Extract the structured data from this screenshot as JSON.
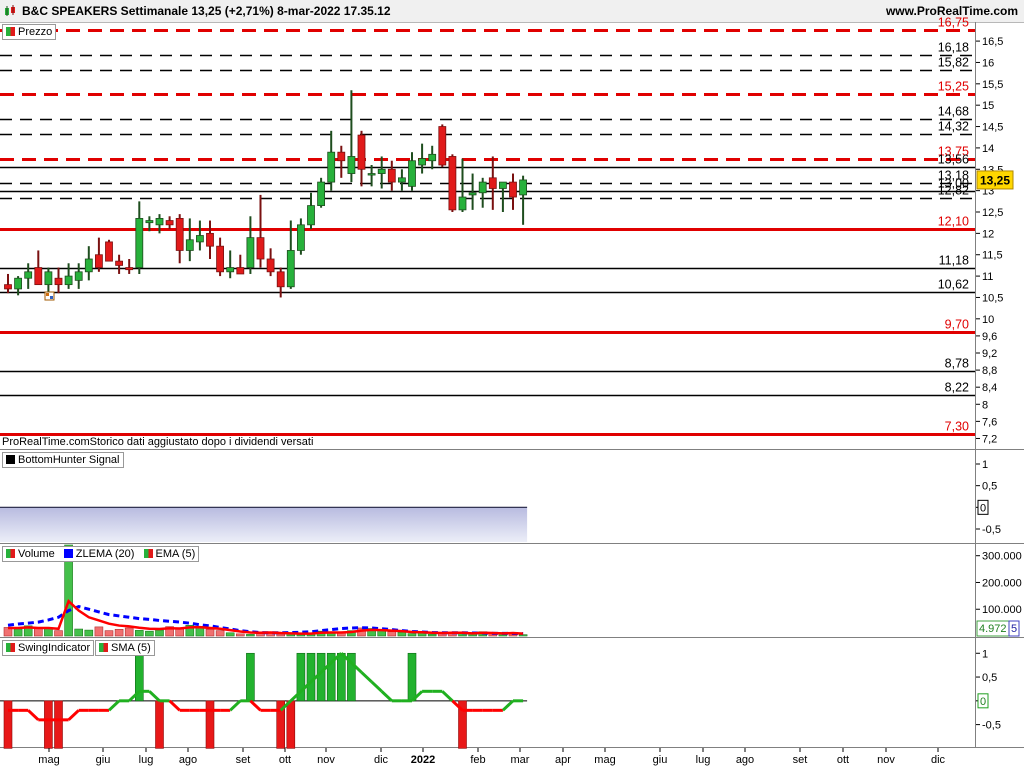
{
  "header": {
    "title": "B&C SPEAKERS Settimanale 13,25 (+2,71%) 8-mar-2022 17.35.12",
    "site": "www.ProRealTime.com"
  },
  "price_panel": {
    "label": "Prezzo",
    "source_note": "ProRealTime.comStorico dati aggiustato dopo i dividendi versati",
    "last_price_tag": "13,25",
    "levels": [
      {
        "value": 16.75,
        "label": "16,75",
        "style": "red-dash",
        "color": "#e00000"
      },
      {
        "value": 16.18,
        "label": "16,18",
        "style": "black-dash",
        "color": "#000000"
      },
      {
        "value": 15.82,
        "label": "15,82",
        "style": "black-dash",
        "color": "#000000"
      },
      {
        "value": 15.25,
        "label": "15,25",
        "style": "red-dash",
        "color": "#e00000"
      },
      {
        "value": 14.68,
        "label": "14,68",
        "style": "black-dash",
        "color": "#000000"
      },
      {
        "value": 14.32,
        "label": "14,32",
        "style": "black-dash",
        "color": "#000000"
      },
      {
        "value": 13.75,
        "label": "13,75",
        "style": "red-dash",
        "color": "#e00000"
      },
      {
        "value": 13.56,
        "label": "13,56",
        "style": "black-solid",
        "color": "#000000"
      },
      {
        "value": 13.18,
        "label": "13,18",
        "style": "black-dash",
        "color": "#000000"
      },
      {
        "value": 13.0,
        "label": "13,00",
        "style": "black-solid",
        "color": "#000000"
      },
      {
        "value": 12.82,
        "label": "12,82",
        "style": "black-dash",
        "color": "#000000"
      },
      {
        "value": 12.1,
        "label": "12,10",
        "style": "red-solid",
        "color": "#e00000"
      },
      {
        "value": 11.18,
        "label": "11,18",
        "style": "black-solid",
        "color": "#000000"
      },
      {
        "value": 10.62,
        "label": "10,62",
        "style": "black-solid",
        "color": "#000000"
      },
      {
        "value": 9.7,
        "label": "9,70",
        "style": "red-solid",
        "color": "#e00000"
      },
      {
        "value": 8.78,
        "label": "8,78",
        "style": "black-solid",
        "color": "#000000"
      },
      {
        "value": 8.22,
        "label": "8,22",
        "style": "black-solid",
        "color": "#000000"
      },
      {
        "value": 7.3,
        "label": "7,30",
        "style": "red-solid",
        "color": "#e00000"
      }
    ]
  },
  "bottomhunter_panel": {
    "label": "BottomHunter Signal",
    "axis_ticks": [
      "1",
      "0,5",
      "0",
      "-0,5"
    ],
    "value_tag": "0"
  },
  "volume_panel": {
    "labels": [
      "Volume",
      "ZLEMA (20)",
      "EMA (5)"
    ],
    "axis_ticks": [
      "300.000",
      "200.000",
      "100.000"
    ],
    "value_tag": "4.972",
    "value_tag2": "5"
  },
  "swing_panel": {
    "labels": [
      "SwingIndicator",
      "SMA (5)"
    ],
    "axis_ticks": [
      "1",
      "0,5",
      "0",
      "-0,5"
    ],
    "value_tag": "0"
  },
  "x_axis": {
    "labels": [
      "mag",
      "giu",
      "lug",
      "ago",
      "set",
      "ott",
      "nov",
      "dic",
      "2022",
      "feb",
      "mar",
      "apr",
      "mag",
      "giu",
      "lug",
      "ago",
      "set",
      "ott",
      "nov",
      "dic"
    ]
  },
  "colors": {
    "up": "#27b13b",
    "down": "#e11a1a",
    "wick": "#1e4d1e",
    "zlema": "#0000ff",
    "ema": "#ff0000",
    "swing_sma": "#20b020"
  },
  "chart_data": [
    {
      "type": "candlestick",
      "title": "B&C SPEAKERS Settimanale",
      "ylim": [
        7.0,
        16.9
      ],
      "y_ticks": [
        16.5,
        16,
        15.5,
        15,
        14.5,
        14,
        13.5,
        13,
        12.5,
        12,
        11.5,
        11,
        10.5,
        10,
        9.6,
        9.2,
        8.8,
        8.4,
        8,
        7.6,
        7.2
      ],
      "y_tick_labels": [
        "16,5",
        "16",
        "15,5",
        "15",
        "14,5",
        "14",
        "13,5",
        "13",
        "12,5",
        "12",
        "11,5",
        "11",
        "10,5",
        "10",
        "9,6",
        "9,2",
        "8,8",
        "8,4",
        "8",
        "7,6",
        "7,2"
      ],
      "candles": [
        {
          "o": 10.8,
          "h": 11.05,
          "l": 10.6,
          "c": 10.7
        },
        {
          "o": 10.7,
          "h": 11.0,
          "l": 10.55,
          "c": 10.95
        },
        {
          "o": 10.95,
          "h": 11.3,
          "l": 10.7,
          "c": 11.1
        },
        {
          "o": 11.2,
          "h": 11.6,
          "l": 10.8,
          "c": 10.8
        },
        {
          "o": 10.8,
          "h": 11.2,
          "l": 10.5,
          "c": 11.1
        },
        {
          "o": 10.95,
          "h": 11.2,
          "l": 10.6,
          "c": 10.8
        },
        {
          "o": 10.8,
          "h": 11.3,
          "l": 10.7,
          "c": 11.0
        },
        {
          "o": 10.9,
          "h": 11.3,
          "l": 10.7,
          "c": 11.1
        },
        {
          "o": 11.1,
          "h": 11.7,
          "l": 10.9,
          "c": 11.4
        },
        {
          "o": 11.5,
          "h": 11.9,
          "l": 11.1,
          "c": 11.2
        },
        {
          "o": 11.8,
          "h": 11.85,
          "l": 11.35,
          "c": 11.35
        },
        {
          "o": 11.35,
          "h": 11.5,
          "l": 11.05,
          "c": 11.25
        },
        {
          "o": 11.2,
          "h": 11.4,
          "l": 11.05,
          "c": 11.15
        },
        {
          "o": 11.2,
          "h": 12.75,
          "l": 11.05,
          "c": 12.35
        },
        {
          "o": 12.25,
          "h": 12.4,
          "l": 12.05,
          "c": 12.3
        },
        {
          "o": 12.2,
          "h": 12.45,
          "l": 12.0,
          "c": 12.35
        },
        {
          "o": 12.3,
          "h": 12.4,
          "l": 12.1,
          "c": 12.2
        },
        {
          "o": 12.35,
          "h": 12.45,
          "l": 11.3,
          "c": 11.6
        },
        {
          "o": 11.6,
          "h": 12.35,
          "l": 11.35,
          "c": 11.85
        },
        {
          "o": 11.8,
          "h": 12.3,
          "l": 11.6,
          "c": 11.95
        },
        {
          "o": 12.0,
          "h": 12.3,
          "l": 11.4,
          "c": 11.7
        },
        {
          "o": 11.7,
          "h": 11.9,
          "l": 11.0,
          "c": 11.1
        },
        {
          "o": 11.1,
          "h": 11.6,
          "l": 10.95,
          "c": 11.2
        },
        {
          "o": 11.2,
          "h": 11.5,
          "l": 11.05,
          "c": 11.05
        },
        {
          "o": 11.2,
          "h": 12.4,
          "l": 11.05,
          "c": 11.9
        },
        {
          "o": 11.9,
          "h": 12.9,
          "l": 11.2,
          "c": 11.4
        },
        {
          "o": 11.4,
          "h": 11.65,
          "l": 11.0,
          "c": 11.1
        },
        {
          "o": 11.1,
          "h": 11.2,
          "l": 10.5,
          "c": 10.75
        },
        {
          "o": 10.75,
          "h": 12.3,
          "l": 10.7,
          "c": 11.6
        },
        {
          "o": 11.6,
          "h": 12.35,
          "l": 11.5,
          "c": 12.2
        },
        {
          "o": 12.2,
          "h": 12.95,
          "l": 12.1,
          "c": 12.65
        },
        {
          "o": 12.65,
          "h": 13.3,
          "l": 12.6,
          "c": 13.2
        },
        {
          "o": 13.2,
          "h": 14.4,
          "l": 13.0,
          "c": 13.9
        },
        {
          "o": 13.9,
          "h": 14.05,
          "l": 13.3,
          "c": 13.7
        },
        {
          "o": 13.4,
          "h": 15.35,
          "l": 13.2,
          "c": 13.8
        },
        {
          "o": 14.3,
          "h": 14.4,
          "l": 13.1,
          "c": 13.5
        },
        {
          "o": 13.4,
          "h": 13.6,
          "l": 13.1,
          "c": 13.4
        },
        {
          "o": 13.4,
          "h": 13.8,
          "l": 13.05,
          "c": 13.5
        },
        {
          "o": 13.5,
          "h": 13.7,
          "l": 13.0,
          "c": 13.2
        },
        {
          "o": 13.2,
          "h": 13.5,
          "l": 13.0,
          "c": 13.3
        },
        {
          "o": 13.1,
          "h": 13.9,
          "l": 13.0,
          "c": 13.7
        },
        {
          "o": 13.6,
          "h": 14.1,
          "l": 13.4,
          "c": 13.75
        },
        {
          "o": 13.7,
          "h": 14.05,
          "l": 13.5,
          "c": 13.85
        },
        {
          "o": 14.5,
          "h": 14.55,
          "l": 13.55,
          "c": 13.6
        },
        {
          "o": 13.8,
          "h": 13.85,
          "l": 12.5,
          "c": 12.55
        },
        {
          "o": 12.55,
          "h": 13.75,
          "l": 12.5,
          "c": 12.85
        },
        {
          "o": 12.9,
          "h": 13.4,
          "l": 12.55,
          "c": 12.95
        },
        {
          "o": 12.95,
          "h": 13.3,
          "l": 12.6,
          "c": 13.2
        },
        {
          "o": 13.3,
          "h": 13.8,
          "l": 12.55,
          "c": 13.05
        },
        {
          "o": 13.05,
          "h": 13.2,
          "l": 12.5,
          "c": 13.2
        },
        {
          "o": 13.2,
          "h": 13.4,
          "l": 12.55,
          "c": 12.85
        },
        {
          "o": 12.9,
          "h": 13.35,
          "l": 12.2,
          "c": 13.25
        }
      ]
    },
    {
      "type": "area",
      "title": "BottomHunter Signal",
      "ylim": [
        -0.8,
        1.3
      ],
      "values": [
        0.0,
        0.0,
        0.0,
        0.0,
        0.0,
        0.0,
        0.0,
        0.0,
        0.0,
        0.0,
        0.0,
        0.0,
        0.0,
        0.0,
        0.0,
        0.0,
        0.0,
        0.0,
        0.0,
        0.0,
        0.0,
        0.0,
        0.0,
        0.0,
        0.0,
        0.0,
        0.0,
        0.0,
        0.0,
        0.0,
        0.0,
        0.0,
        0.0,
        0.0,
        0.0,
        0.0,
        0.0,
        0.0,
        0.0,
        0.0,
        0.0,
        0.0,
        0.0,
        0.0,
        0.0,
        0.0,
        0.0,
        0.0,
        0.0,
        0.0,
        0.0,
        0.0
      ]
    },
    {
      "type": "bar",
      "title": "Volume",
      "ylim": [
        0,
        340000
      ],
      "series": [
        {
          "name": "Volume",
          "values": [
            32000,
            26000,
            38000,
            28000,
            30000,
            20000,
            340000,
            26000,
            22000,
            34000,
            20000,
            25000,
            30000,
            21000,
            18000,
            22000,
            35000,
            26000,
            40000,
            36000,
            25000,
            20000,
            12000,
            8000,
            6000,
            9000,
            14000,
            7000,
            10000,
            6000,
            8000,
            18000,
            16000,
            12000,
            20000,
            30000,
            28000,
            22000,
            16000,
            14000,
            9000,
            11000,
            7000,
            9000,
            14000,
            12000,
            8000,
            16000,
            10000,
            9000,
            12000,
            5000
          ]
        },
        {
          "name": "ZLEMA (20)",
          "values": [
            40000,
            45000,
            48000,
            52000,
            60000,
            70000,
            95000,
            110000,
            100000,
            90000,
            80000,
            75000,
            70000,
            65000,
            62000,
            58000,
            55000,
            52000,
            48000,
            42000,
            38000,
            32000,
            26000,
            20000,
            16000,
            13000,
            12000,
            12000,
            13000,
            14000,
            16000,
            20000,
            24000,
            28000,
            30000,
            31000,
            30000,
            27000,
            24000,
            20000,
            17000,
            15000,
            13000,
            12000,
            12000,
            12000,
            11000,
            11000,
            10000,
            10000,
            9500,
            9000
          ]
        },
        {
          "name": "EMA (5)",
          "values": [
            30000,
            30000,
            32000,
            30000,
            30000,
            27000,
            130000,
            95000,
            70000,
            58000,
            46000,
            39000,
            36000,
            31000,
            27000,
            26000,
            29000,
            28000,
            32000,
            33000,
            30000,
            27000,
            22000,
            17000,
            13000,
            12000,
            13000,
            11000,
            10000,
            9000,
            9000,
            12000,
            13000,
            13000,
            15000,
            20000,
            23000,
            22000,
            20000,
            18000,
            15000,
            14000,
            12000,
            11000,
            12000,
            12000,
            10000,
            12000,
            11000,
            10000,
            11000,
            9000
          ]
        }
      ]
    },
    {
      "type": "bar",
      "title": "SwingIndicator",
      "ylim": [
        -0.95,
        1.3
      ],
      "series": [
        {
          "name": "SwingIndicator",
          "values": [
            -1,
            0,
            0,
            0,
            -1,
            -1,
            0,
            0,
            0,
            0,
            0,
            0,
            0,
            1,
            0,
            -1,
            0,
            0,
            0,
            0,
            -1,
            0,
            0,
            0,
            1,
            0,
            0,
            -1,
            -1,
            1,
            1,
            1,
            1,
            1,
            1,
            0,
            0,
            0,
            0,
            0,
            1,
            0,
            0,
            0,
            0,
            -1,
            0,
            0,
            0,
            0,
            0,
            0
          ]
        },
        {
          "name": "SMA (5)",
          "values": [
            -0.2,
            -0.2,
            -0.2,
            -0.4,
            -0.4,
            -0.4,
            -0.4,
            -0.2,
            -0.2,
            -0.2,
            -0.2,
            0.0,
            0.0,
            0.2,
            0.2,
            0.0,
            0.0,
            -0.2,
            -0.2,
            -0.2,
            -0.2,
            -0.2,
            -0.2,
            0.0,
            0.0,
            -0.2,
            -0.2,
            -0.2,
            0.0,
            0.2,
            0.4,
            0.6,
            0.8,
            1.0,
            0.8,
            0.6,
            0.4,
            0.2,
            0.0,
            0.0,
            0.0,
            0.2,
            0.2,
            0.2,
            0.0,
            -0.2,
            -0.2,
            -0.2,
            -0.2,
            -0.2,
            0.0,
            0.0
          ]
        }
      ]
    }
  ]
}
